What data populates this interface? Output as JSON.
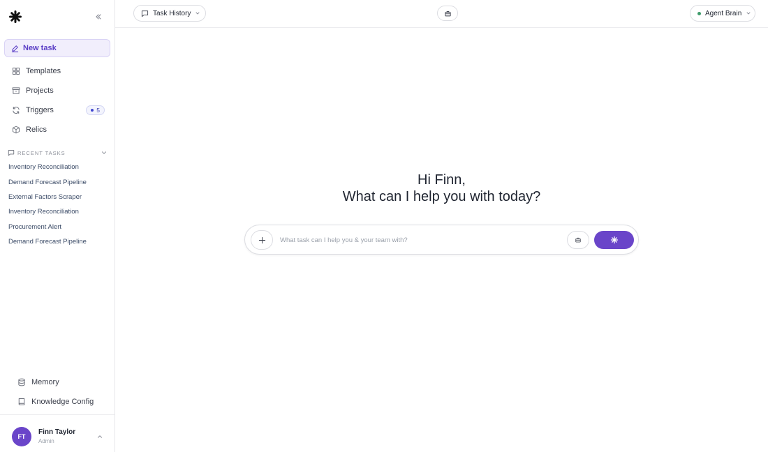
{
  "sidebar": {
    "new_task_label": "New task",
    "nav": [
      {
        "label": "Templates",
        "icon": "grid-icon"
      },
      {
        "label": "Projects",
        "icon": "archive-icon"
      },
      {
        "label": "Triggers",
        "icon": "refresh-icon",
        "badge": "5"
      },
      {
        "label": "Relics",
        "icon": "box-icon"
      }
    ],
    "recent_header": "RECENT TASKS",
    "recent_tasks": [
      "Inventory Reconciliation",
      "Demand Forecast Pipeline",
      "External Factors Scraper",
      "Inventory Reconciliation",
      "Procurement Alert",
      "Demand Forecast Pipeline"
    ],
    "bottom_nav": [
      {
        "label": "Memory",
        "icon": "database-icon"
      },
      {
        "label": "Knowledge Config",
        "icon": "book-icon"
      }
    ],
    "user": {
      "initials": "FT",
      "name": "Finn Taylor",
      "role": "Admin"
    }
  },
  "topbar": {
    "task_history_label": "Task History",
    "agent_label": "Agent Brain"
  },
  "main": {
    "greeting_line1": "Hi Finn,",
    "greeting_line2": "What can I help you with today?",
    "input_placeholder": "What task can I help you & your team with?"
  },
  "colors": {
    "accent": "#6a45c9",
    "accent_light": "#f1eefc",
    "status_online": "#3e9b6b",
    "badge_blue": "#4046d1"
  }
}
